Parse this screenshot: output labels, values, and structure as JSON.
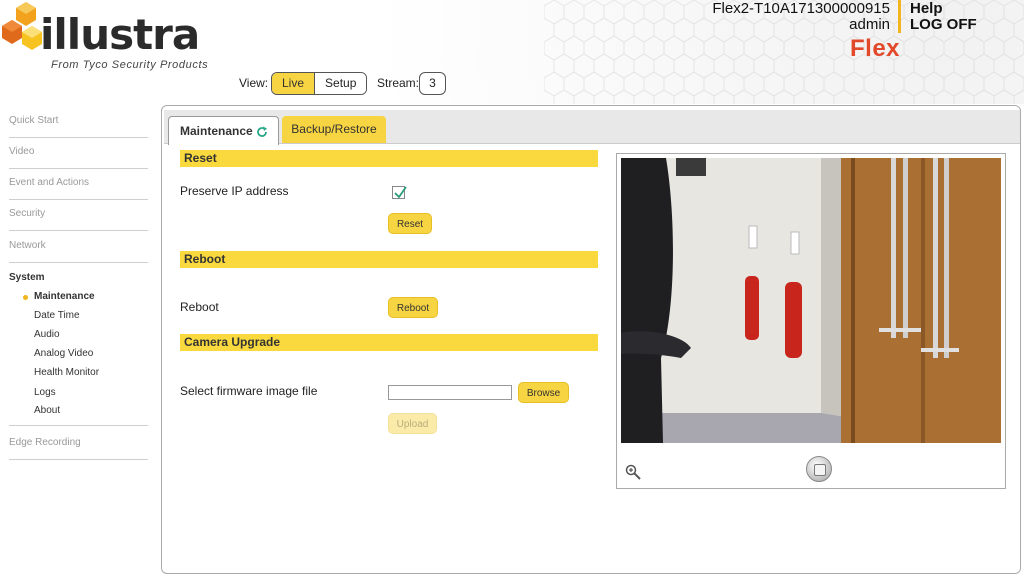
{
  "brand": {
    "logo_text": "illustra",
    "tagline": "From Tyco Security Products",
    "product": "Flex"
  },
  "header": {
    "device_name": "Flex2-T10A171300000915",
    "user": "admin",
    "help_label": "Help",
    "logoff_label": "LOG OFF"
  },
  "view": {
    "label": "View:",
    "live_label": "Live",
    "setup_label": "Setup",
    "stream_label": "Stream:",
    "stream_value": "3"
  },
  "sidebar": {
    "items": [
      "Quick Start",
      "Video",
      "Event and Actions",
      "Security",
      "Network"
    ],
    "system_title": "System",
    "system_items": [
      "Maintenance",
      "Date Time",
      "Audio",
      "Analog Video",
      "Health Monitor",
      "Logs",
      "About"
    ],
    "active_item": "Maintenance",
    "edge_recording": "Edge Recording"
  },
  "tabs": {
    "maintenance": "Maintenance",
    "backup_restore": "Backup/Restore"
  },
  "reset": {
    "title": "Reset",
    "preserve_label": "Preserve IP address",
    "preserve_checked": true,
    "button": "Reset"
  },
  "reboot": {
    "title": "Reboot",
    "label": "Reboot",
    "button": "Reboot"
  },
  "upgrade": {
    "title": "Camera Upgrade",
    "file_label": "Select firmware image file",
    "file_value": "",
    "browse_button": "Browse",
    "upload_button": "Upload"
  },
  "video": {
    "zoom_icon": "zoom-in-icon",
    "stop_icon": "stop-icon"
  },
  "colors": {
    "accent_yellow": "#f7d441",
    "section_yellow": "#f9d93d",
    "brand_red": "#e2492a",
    "divider_orange": "#f2b51d"
  }
}
